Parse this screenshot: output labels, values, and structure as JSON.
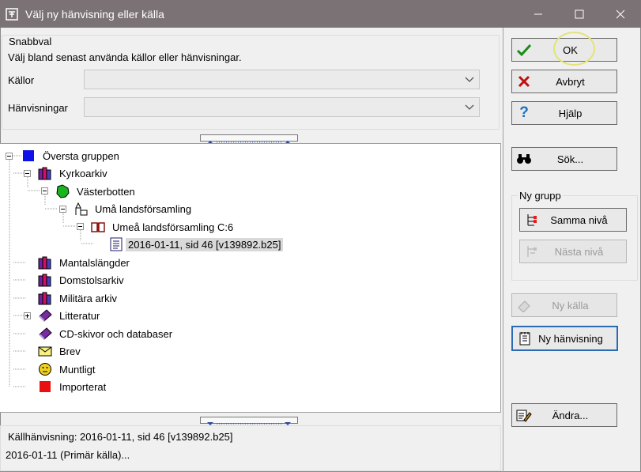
{
  "window": {
    "title": "Välj ny hänvisning eller källa"
  },
  "quick": {
    "legend": "Snabbval",
    "description": "Välj bland senast använda källor eller hänvisningar.",
    "sources_label": "Källor",
    "refs_label": "Hänvisningar",
    "sources_value": "",
    "refs_value": ""
  },
  "tree": {
    "nodes": [
      {
        "label": "Översta gruppen",
        "icon": "blue-square-icon"
      },
      {
        "label": "Kyrkoarkiv",
        "icon": "books-icon"
      },
      {
        "label": "Västerbotten",
        "icon": "green-map-icon"
      },
      {
        "label": "Umå landsförsamling",
        "icon": "church-icon"
      },
      {
        "label": "Umeå landsförsamling C:6",
        "icon": "book-icon"
      },
      {
        "label": "2016-01-11, sid  46 [v139892.b25]",
        "icon": "document-icon"
      },
      {
        "label": "Mantalslängder",
        "icon": "books-icon"
      },
      {
        "label": "Domstolsarkiv",
        "icon": "books-icon"
      },
      {
        "label": "Militära arkiv",
        "icon": "books-icon"
      },
      {
        "label": "Litteratur",
        "icon": "purple-book-icon"
      },
      {
        "label": "CD-skivor och databaser",
        "icon": "purple-book-icon"
      },
      {
        "label": "Brev",
        "icon": "envelope-icon"
      },
      {
        "label": "Muntligt",
        "icon": "face-icon"
      },
      {
        "label": "Importerat",
        "icon": "red-square-icon"
      }
    ]
  },
  "info": {
    "line1": "Källhänvisning: 2016-01-11, sid  46 [v139892.b25]",
    "line2": "2016-01-11 (Primär källa)..."
  },
  "buttons": {
    "ok": "OK",
    "cancel": "Avbryt",
    "help": "Hjälp",
    "search": "Sök...",
    "new_group": "Ny grupp",
    "same_level": "Samma nivå",
    "next_level": "Nästa nivå",
    "new_source": "Ny källa",
    "new_ref": "Ny hänvisning",
    "edit": "Ändra..."
  },
  "colors": {
    "titlebar": "#7a7274",
    "accent_focus": "#2a6bb3",
    "ok_check": "#1a8a1a",
    "cancel_x": "#c01010"
  }
}
